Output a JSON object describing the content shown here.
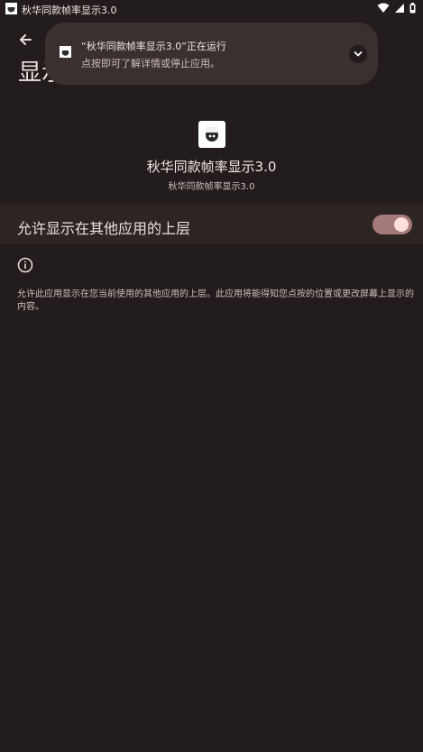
{
  "status_bar": {
    "title": "秋华同款帧率显示3.0",
    "icons": [
      "app-icon",
      "wifi-icon",
      "signal-icon",
      "battery-icon"
    ]
  },
  "page": {
    "title": "显示"
  },
  "notification": {
    "title": "“秋华同款帧率显示3.0”正在运行",
    "subtitle": "点按即可了解详情或停止应用。",
    "icon": "expand-chevron-icon"
  },
  "app_info": {
    "name": "秋华同款帧率显示3.0",
    "package": "秋华同款帧率显示3.0"
  },
  "setting": {
    "label": "允许显示在其他应用的上层",
    "enabled": true
  },
  "description": "允许此应用显示在您当前使用的其他应用的上层。此应用将能得知您点按的位置或更改屏幕上显示的内容。",
  "colors": {
    "background": "#231c1c",
    "row_background": "#2d2524",
    "notification_background": "#3a302f",
    "toggle_track": "#a57a7b",
    "toggle_knob": "#ffdede"
  }
}
